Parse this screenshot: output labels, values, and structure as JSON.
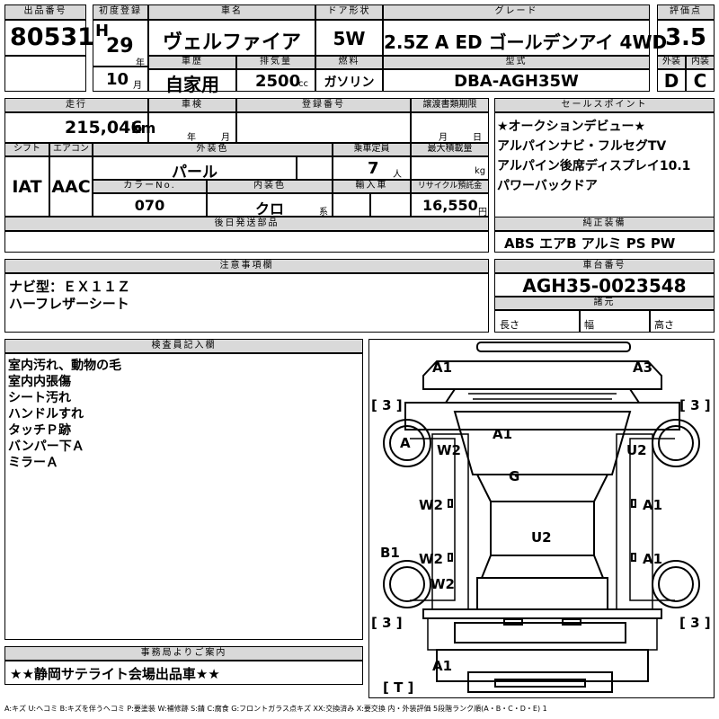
{
  "labels": {
    "lot": "出品番号",
    "first_reg": "初度登録",
    "car_name": "車名",
    "door": "ドア形状",
    "grade": "グレード",
    "score": "評価点",
    "history": "車歴",
    "displacement": "排気量",
    "fuel": "燃料",
    "model": "型式",
    "exterior": "外装",
    "interior": "内装",
    "mileage": "走行",
    "inspection": "車検",
    "reg_no": "登録番号",
    "transfer_deadline": "譲渡書類期限",
    "sales_points": "セールスポイント",
    "shift": "シフト",
    "aircon": "エアコン",
    "ext_color": "外装色",
    "capacity": "乗車定員",
    "max_load": "最大積載量",
    "color_no": "カラーNo.",
    "int_color": "内装色",
    "import": "輸入車",
    "recycle": "リサイクル預託金",
    "later_parts": "後日発送部品",
    "options": "純正装備",
    "notes": "注意事項欄",
    "chassis": "車台番号",
    "specs": "諸元",
    "inspector": "検査員記入欄",
    "office": "事務局よりご案内"
  },
  "lot_number": "80531",
  "first_reg": {
    "era": "H",
    "year": "29",
    "year_unit": "年",
    "month": "10",
    "month_unit": "月"
  },
  "car_name": "ヴェルファイア",
  "door": "5W",
  "grade": "2.5Z A ED ゴールデンアイ 4WD",
  "score": "3.5",
  "history": "自家用",
  "displacement": "2500",
  "displacement_unit": "cc",
  "fuel": "ガソリン",
  "model": "DBA-AGH35W",
  "exterior_grade": "D",
  "interior_grade": "C",
  "mileage": "215,046",
  "mileage_unit": "km",
  "inspection_year_unit": "年",
  "inspection_month_unit": "月",
  "transfer_month_unit": "月",
  "transfer_day_unit": "日",
  "sales_points": [
    "★オークションデビュー★",
    "アルパインナビ・フルセグTV",
    "アルパイン後席ディスプレイ10.1",
    "パワーバックドア"
  ],
  "shift": "IAT",
  "aircon": "AAC",
  "ext_color": "パール",
  "capacity": "7",
  "capacity_unit": "人",
  "max_load_unit": "kg",
  "color_no": "070",
  "int_color": "クロ",
  "int_color_unit": "系",
  "recycle": "16,550",
  "recycle_unit": "円",
  "options": "ABS エアB アルミ PS PW",
  "notes": [
    "ナビ型：ＥＸ１１Ｚ",
    "ハーフレザーシート"
  ],
  "chassis": "AGH35-0023548",
  "spec_length": "長さ",
  "spec_width": "幅",
  "spec_height": "高さ",
  "inspector_notes": [
    "室内汚れ、動物の毛",
    "室内内張傷",
    "シート汚れ",
    "ハンドルすれ",
    "タッチＰ跡",
    "バンパー下Ａ",
    "ミラーＡ"
  ],
  "office_note": "★★静岡サテライト会場出品車★★",
  "diagram": {
    "front_left": "A1",
    "front_right": "A3",
    "tire_fl": "[ 3 ]",
    "tire_fr": "[ 3 ]",
    "tire_rl": "[ 3 ]",
    "tire_rr": "[ 3 ]",
    "spare": "[ T ]",
    "wheel_fl": "A",
    "hood": "A1",
    "fender_l": "W2",
    "fender_r": "U2",
    "roof": "G",
    "door_fl": "W2",
    "door_fr": "A1",
    "rocker_l": "B1",
    "door_rl": "W2",
    "door_rr": "A1",
    "roof_rear": "U2",
    "quarter_l": "W2",
    "rear_bumper": "A1"
  },
  "legend": "A:キズ U:ヘコミ B:キズを伴うヘコミ P:要塗装 W:補修跡 S:錆 C:腐食 G:フロントガラス点キズ XX:交換済み X:要交換 内・外装評価 5段階ランク順(A・B・C・D・E) 1"
}
